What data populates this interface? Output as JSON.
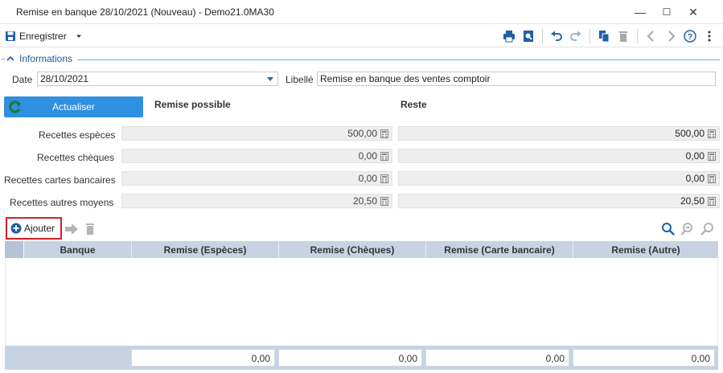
{
  "window": {
    "title": "Remise en banque 28/10/2021 (Nouveau) - Demo21.0MA30",
    "minimize": "—",
    "maximize": "☐",
    "close": "✕"
  },
  "toolbar": {
    "save_label": "Enregistrer",
    "icons": [
      "print-icon",
      "print-preview-icon",
      "undo-icon",
      "redo-icon",
      "copy-icon",
      "delete-icon",
      "previous-icon",
      "next-icon",
      "help-icon",
      "more-icon"
    ]
  },
  "informations": {
    "header": "Informations",
    "date_label": "Date",
    "date_value": "28/10/2021",
    "libelle_label": "Libellé",
    "libelle_value": "Remise en banque des ventes comptoir"
  },
  "actualiser_label": "Actualiser",
  "columns": {
    "remise_possible": "Remise possible",
    "reste": "Reste"
  },
  "recettes": [
    {
      "label": "Recettes espèces",
      "possible": "500,00",
      "reste": "500,00"
    },
    {
      "label": "Recettes chèques",
      "possible": "0,00",
      "reste": "0,00"
    },
    {
      "label": "Recettes cartes bancaires",
      "possible": "0,00",
      "reste": "0,00"
    },
    {
      "label": "Recettes autres moyens",
      "possible": "20,50",
      "reste": "20,50"
    }
  ],
  "grid": {
    "add_label": "Ajouter",
    "headers": [
      "Banque",
      "Remise (Espèces)",
      "Remise (Chèques)",
      "Remise (Carte bancaire)",
      "Remise (Autre)"
    ],
    "totals": [
      "0,00",
      "0,00",
      "0,00",
      "0,00"
    ]
  },
  "colors": {
    "accent": "#2f8fe0",
    "grid_header": "#c7d3e3",
    "highlight_border": "#d61f26",
    "group_header_text": "#1b5a96"
  }
}
